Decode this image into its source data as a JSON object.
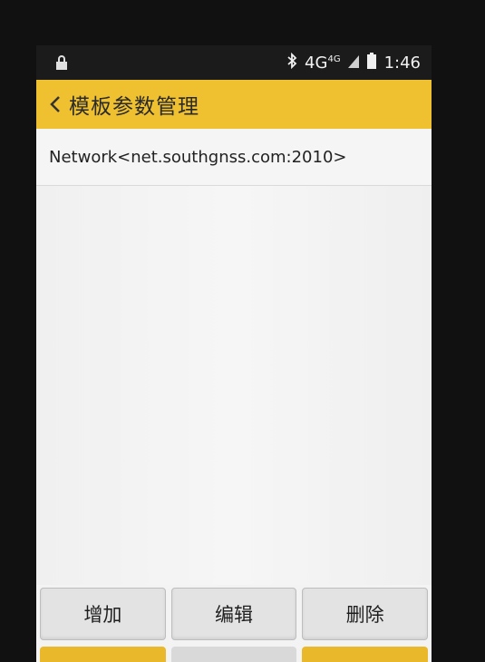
{
  "statusbar": {
    "network": "4G",
    "network_sup": "4G",
    "time": "1:46",
    "icons": [
      "lock-icon",
      "bluetooth-icon",
      "signal-icon",
      "battery-icon"
    ]
  },
  "appbar": {
    "title": "模板参数管理",
    "color": "#efc02f"
  },
  "list": {
    "items": [
      {
        "label": "Network<net.southgnss.com:2010>"
      }
    ]
  },
  "buttons": {
    "add": "增加",
    "edit": "编辑",
    "delete": "删除"
  }
}
